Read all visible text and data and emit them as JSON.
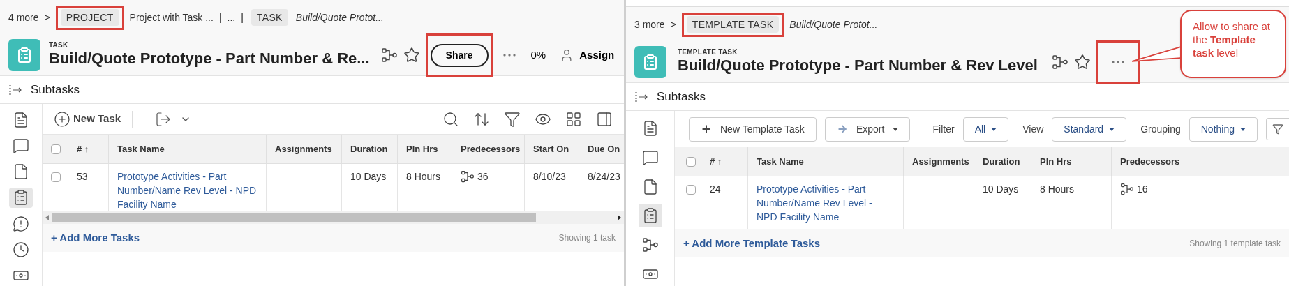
{
  "panels": [
    {
      "kind": "task",
      "breadcrumb": [
        {
          "kind": "more",
          "text": "4 more"
        },
        {
          "kind": "chevron",
          "text": ">"
        },
        {
          "kind": "tag",
          "text": "PROJECT",
          "highlighted": true
        },
        {
          "kind": "plain",
          "text": "Project with Task ..."
        },
        {
          "kind": "separator",
          "text": "|"
        },
        {
          "kind": "plain",
          "text": "..."
        },
        {
          "kind": "separator",
          "text": "|"
        },
        {
          "kind": "tag",
          "text": "TASK",
          "highlighted": false
        },
        {
          "kind": "italic",
          "text": "Build/Quote Protot..."
        }
      ],
      "type_label": "TASK",
      "title": "Build/Quote Prototype - Part Number & Re...",
      "share": {
        "label": "Share",
        "highlighted": true
      },
      "more_highlighted": false,
      "percent": "0%",
      "assignee": "Assign",
      "subtasks": "Subtasks",
      "sidebar": [
        {
          "kind": "document",
          "selected": false
        },
        {
          "kind": "comment",
          "selected": false
        },
        {
          "kind": "file",
          "selected": false
        },
        {
          "kind": "clipboard",
          "selected": true
        },
        {
          "kind": "issue",
          "selected": false
        },
        {
          "kind": "clock",
          "selected": false
        },
        {
          "kind": "money",
          "selected": false
        }
      ],
      "toolbar": {
        "kind": "icons",
        "new_button": "New Task"
      },
      "table": {
        "header_checked": false,
        "columns": [
          "# ↑",
          "Task Name",
          "Assignments",
          "Duration",
          "Pln Hrs",
          "Predecessors",
          "Start On",
          "Due On"
        ],
        "rows": [
          {
            "checked": false,
            "cells": [
              "53",
              "Prototype Activities - Part Number/Name Rev Level - NPD Facility Name",
              "",
              "10 Days",
              "8 Hours",
              "36",
              "8/10/23",
              "8/24/23"
            ]
          }
        ]
      },
      "scrollbar": true,
      "add_more": "+ Add More Tasks",
      "showing": "Showing 1 task"
    },
    {
      "kind": "template",
      "breadcrumb": [
        {
          "kind": "more",
          "text": "3 more"
        },
        {
          "kind": "chevron",
          "text": ">"
        },
        {
          "kind": "tag",
          "text": "TEMPLATE TASK",
          "highlighted": true
        },
        {
          "kind": "italic",
          "text": "Build/Quote Protot..."
        }
      ],
      "type_label": "TEMPLATE TASK",
      "title": "Build/Quote Prototype - Part Number & Rev Level",
      "more_highlighted": true,
      "subtasks": "Subtasks",
      "sidebar": [
        {
          "kind": "document",
          "selected": false
        },
        {
          "kind": "comment",
          "selected": false
        },
        {
          "kind": "file",
          "selected": false
        },
        {
          "kind": "clipboard",
          "selected": true
        },
        {
          "kind": "dependency",
          "selected": false
        },
        {
          "kind": "money",
          "selected": false
        }
      ],
      "toolbar": {
        "kind": "buttons",
        "new_button": "New Template Task",
        "export": "Export",
        "dropdowns": [
          {
            "label": "Filter",
            "value": "All"
          },
          {
            "label": "View",
            "value": "Standard"
          },
          {
            "label": "Grouping",
            "value": "Nothing"
          }
        ]
      },
      "table": {
        "header_checked": false,
        "columns": [
          "# ↑",
          "Task Name",
          "Assignments",
          "Duration",
          "Pln Hrs",
          "Predecessors"
        ],
        "rows": [
          {
            "checked": false,
            "cells": [
              "24",
              "Prototype Activities - Part Number/Name Rev Level - NPD Facility Name",
              "",
              "10 Days",
              "8 Hours",
              "16"
            ]
          }
        ]
      },
      "scrollbar": false,
      "add_more": "+ Add More Template Tasks",
      "showing": "Showing 1 template task",
      "callout": "Allow to share at the **Template task** level"
    }
  ]
}
